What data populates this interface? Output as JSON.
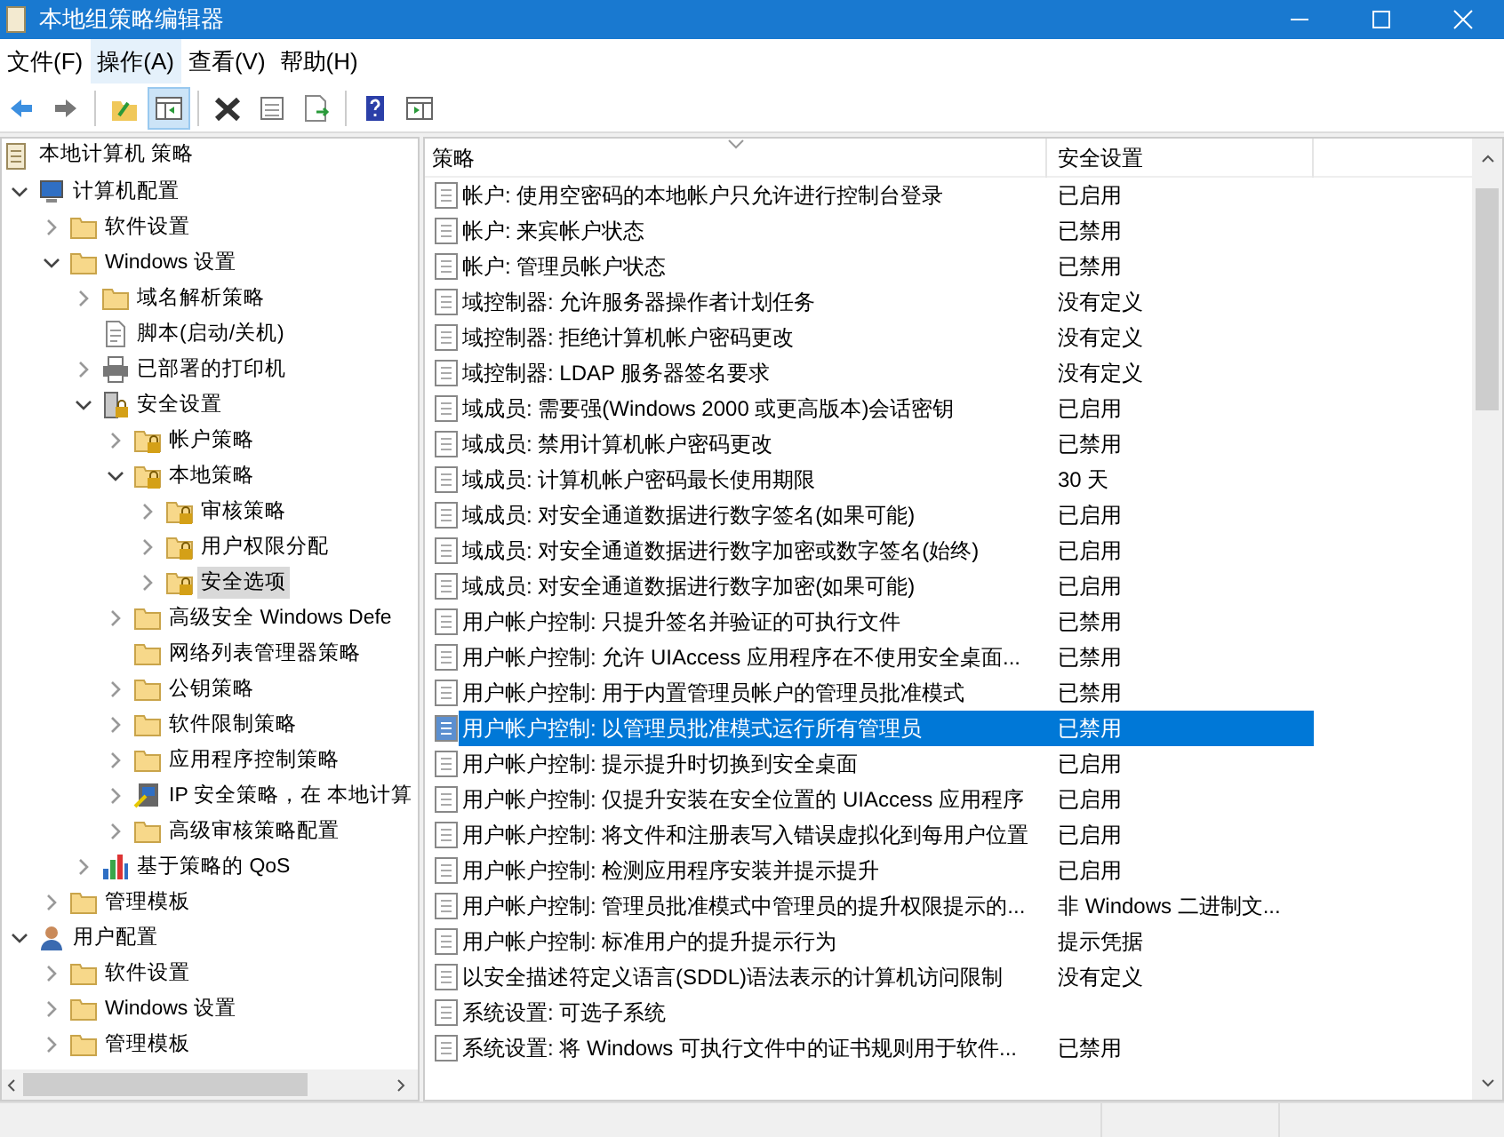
{
  "window": {
    "title": "本地组策略编辑器"
  },
  "menu": [
    {
      "label": "文件(F)",
      "selected": false
    },
    {
      "label": "操作(A)",
      "selected": true
    },
    {
      "label": "查看(V)",
      "selected": false
    },
    {
      "label": "帮助(H)",
      "selected": false
    }
  ],
  "toolbar": [
    [
      {
        "kind": "back",
        "pressed": false
      },
      {
        "kind": "forward",
        "pressed": false
      }
    ],
    [
      {
        "kind": "up",
        "pressed": false
      },
      {
        "kind": "tree",
        "pressed": true
      }
    ],
    [
      {
        "kind": "delete",
        "pressed": false
      },
      {
        "kind": "properties",
        "pressed": false
      },
      {
        "kind": "export",
        "pressed": false
      }
    ],
    [
      {
        "kind": "help",
        "pressed": false
      },
      {
        "kind": "pane",
        "pressed": false
      }
    ]
  ],
  "tree": {
    "root": {
      "label": "本地计算机 策略",
      "kind": "scroll",
      "children": [
        {
          "label": "计算机配置",
          "kind": "computer",
          "expandable": true,
          "expanded": true,
          "selected": false,
          "children": [
            {
              "label": "软件设置",
              "kind": "folder",
              "expandable": true,
              "expanded": false,
              "selected": false
            },
            {
              "label": "Windows 设置",
              "kind": "folder",
              "expandable": true,
              "expanded": true,
              "selected": false,
              "children": [
                {
                  "label": "域名解析策略",
                  "kind": "folder",
                  "expandable": true,
                  "expanded": false,
                  "selected": false
                },
                {
                  "label": "脚本(启动/关机)",
                  "kind": "script",
                  "expandable": false,
                  "selected": false
                },
                {
                  "label": "已部署的打印机",
                  "kind": "printer",
                  "expandable": true,
                  "expanded": false,
                  "selected": false
                },
                {
                  "label": "安全设置",
                  "kind": "security",
                  "expandable": true,
                  "expanded": true,
                  "selected": false,
                  "children": [
                    {
                      "label": "帐户策略",
                      "kind": "lockfolder",
                      "expandable": true,
                      "expanded": false,
                      "selected": false
                    },
                    {
                      "label": "本地策略",
                      "kind": "lockfolder",
                      "expandable": true,
                      "expanded": true,
                      "selected": false,
                      "children": [
                        {
                          "label": "审核策略",
                          "kind": "lockfolder",
                          "expandable": true,
                          "expanded": false,
                          "selected": false
                        },
                        {
                          "label": "用户权限分配",
                          "kind": "lockfolder",
                          "expandable": true,
                          "expanded": false,
                          "selected": false
                        },
                        {
                          "label": "安全选项",
                          "kind": "lockfolder",
                          "expandable": true,
                          "expanded": false,
                          "selected": true
                        }
                      ]
                    },
                    {
                      "label": "高级安全 Windows Defe",
                      "kind": "folder",
                      "expandable": true,
                      "expanded": false,
                      "selected": false
                    },
                    {
                      "label": "网络列表管理器策略",
                      "kind": "folder",
                      "expandable": false,
                      "selected": false
                    },
                    {
                      "label": "公钥策略",
                      "kind": "folder",
                      "expandable": true,
                      "expanded": false,
                      "selected": false
                    },
                    {
                      "label": "软件限制策略",
                      "kind": "folder",
                      "expandable": true,
                      "expanded": false,
                      "selected": false
                    },
                    {
                      "label": "应用程序控制策略",
                      "kind": "folder",
                      "expandable": true,
                      "expanded": false,
                      "selected": false
                    },
                    {
                      "label": "IP 安全策略，在 本地计算",
                      "kind": "ip",
                      "expandable": true,
                      "expanded": false,
                      "selected": false
                    },
                    {
                      "label": "高级审核策略配置",
                      "kind": "folder",
                      "expandable": true,
                      "expanded": false,
                      "selected": false
                    }
                  ]
                },
                {
                  "label": "基于策略的 QoS",
                  "kind": "chart",
                  "expandable": true,
                  "expanded": false,
                  "selected": false
                }
              ]
            },
            {
              "label": "管理模板",
              "kind": "folder",
              "expandable": true,
              "expanded": false,
              "selected": false
            }
          ]
        },
        {
          "label": "用户配置",
          "kind": "user",
          "expandable": true,
          "expanded": true,
          "selected": false,
          "children": [
            {
              "label": "软件设置",
              "kind": "folder",
              "expandable": true,
              "expanded": false,
              "selected": false
            },
            {
              "label": "Windows 设置",
              "kind": "folder",
              "expandable": true,
              "expanded": false,
              "selected": false
            },
            {
              "label": "管理模板",
              "kind": "folder",
              "expandable": true,
              "expanded": false,
              "selected": false
            }
          ]
        }
      ]
    }
  },
  "table": {
    "columns": [
      "策略",
      "安全设置"
    ],
    "rows": [
      {
        "policy": "帐户: 使用空密码的本地帐户只允许进行控制台登录",
        "setting": "已启用",
        "selected": false
      },
      {
        "policy": "帐户: 来宾帐户状态",
        "setting": "已禁用",
        "selected": false
      },
      {
        "policy": "帐户: 管理员帐户状态",
        "setting": "已禁用",
        "selected": false
      },
      {
        "policy": "域控制器: 允许服务器操作者计划任务",
        "setting": "没有定义",
        "selected": false
      },
      {
        "policy": "域控制器: 拒绝计算机帐户密码更改",
        "setting": "没有定义",
        "selected": false
      },
      {
        "policy": "域控制器: LDAP 服务器签名要求",
        "setting": "没有定义",
        "selected": false
      },
      {
        "policy": "域成员: 需要强(Windows 2000 或更高版本)会话密钥",
        "setting": "已启用",
        "selected": false
      },
      {
        "policy": "域成员: 禁用计算机帐户密码更改",
        "setting": "已禁用",
        "selected": false
      },
      {
        "policy": "域成员: 计算机帐户密码最长使用期限",
        "setting": "30 天",
        "selected": false
      },
      {
        "policy": "域成员: 对安全通道数据进行数字签名(如果可能)",
        "setting": "已启用",
        "selected": false
      },
      {
        "policy": "域成员: 对安全通道数据进行数字加密或数字签名(始终)",
        "setting": "已启用",
        "selected": false
      },
      {
        "policy": "域成员: 对安全通道数据进行数字加密(如果可能)",
        "setting": "已启用",
        "selected": false
      },
      {
        "policy": "用户帐户控制: 只提升签名并验证的可执行文件",
        "setting": "已禁用",
        "selected": false
      },
      {
        "policy": "用户帐户控制: 允许 UIAccess 应用程序在不使用安全桌面...",
        "setting": "已禁用",
        "selected": false
      },
      {
        "policy": "用户帐户控制: 用于内置管理员帐户的管理员批准模式",
        "setting": "已禁用",
        "selected": false
      },
      {
        "policy": "用户帐户控制: 以管理员批准模式运行所有管理员",
        "setting": "已禁用",
        "selected": true
      },
      {
        "policy": "用户帐户控制: 提示提升时切换到安全桌面",
        "setting": "已启用",
        "selected": false
      },
      {
        "policy": "用户帐户控制: 仅提升安装在安全位置的 UIAccess 应用程序",
        "setting": "已启用",
        "selected": false
      },
      {
        "policy": "用户帐户控制: 将文件和注册表写入错误虚拟化到每用户位置",
        "setting": "已启用",
        "selected": false
      },
      {
        "policy": "用户帐户控制: 检测应用程序安装并提示提升",
        "setting": "已启用",
        "selected": false
      },
      {
        "policy": "用户帐户控制: 管理员批准模式中管理员的提升权限提示的...",
        "setting": "非 Windows 二进制文...",
        "selected": false
      },
      {
        "policy": "用户帐户控制: 标准用户的提升提示行为",
        "setting": "提示凭据",
        "selected": false
      },
      {
        "policy": "以安全描述符定义语言(SDDL)语法表示的计算机访问限制",
        "setting": "没有定义",
        "selected": false
      },
      {
        "policy": "系统设置: 可选子系统",
        "selected": false
      },
      {
        "policy": "系统设置: 将 Windows 可执行文件中的证书规则用于软件...",
        "setting": "已禁用",
        "selected": false
      }
    ]
  }
}
